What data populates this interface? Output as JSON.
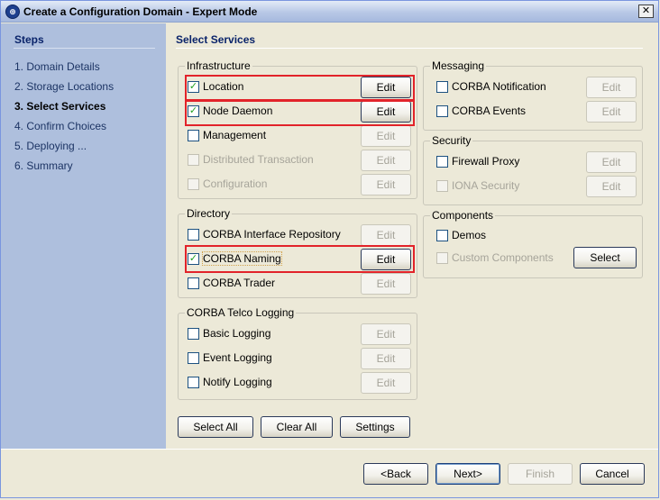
{
  "window": {
    "title": "Create a Configuration Domain - Expert Mode",
    "app_icon_glyph": "⊕",
    "close_glyph": "✕"
  },
  "steps": {
    "heading": "Steps",
    "items": [
      {
        "label": "1. Domain Details",
        "active": false
      },
      {
        "label": "2. Storage Locations",
        "active": false
      },
      {
        "label": "3. Select Services",
        "active": true
      },
      {
        "label": "4. Confirm Choices",
        "active": false
      },
      {
        "label": "5. Deploying ...",
        "active": false
      },
      {
        "label": "6. Summary",
        "active": false
      }
    ]
  },
  "main": {
    "heading": "Select Services"
  },
  "infrastructure": {
    "label": "Infrastructure",
    "items": [
      {
        "label": "Location",
        "checked": true,
        "enabled": true,
        "edit": "Edit",
        "edit_enabled": true
      },
      {
        "label": "Node Daemon",
        "checked": true,
        "enabled": true,
        "edit": "Edit",
        "edit_enabled": true
      },
      {
        "label": "Management",
        "checked": false,
        "enabled": true,
        "edit": "Edit",
        "edit_enabled": false
      },
      {
        "label": "Distributed Transaction",
        "checked": false,
        "enabled": false,
        "edit": "Edit",
        "edit_enabled": false
      },
      {
        "label": "Configuration",
        "checked": false,
        "enabled": false,
        "edit": "Edit",
        "edit_enabled": false
      }
    ]
  },
  "directory": {
    "label": "Directory",
    "items": [
      {
        "label": "CORBA Interface Repository",
        "checked": false,
        "enabled": true,
        "edit": "Edit",
        "edit_enabled": false
      },
      {
        "label": "CORBA Naming",
        "checked": true,
        "enabled": true,
        "edit": "Edit",
        "edit_enabled": true
      },
      {
        "label": "CORBA Trader",
        "checked": false,
        "enabled": true,
        "edit": "Edit",
        "edit_enabled": false
      }
    ]
  },
  "telco": {
    "label": "CORBA Telco Logging",
    "items": [
      {
        "label": "Basic Logging",
        "checked": false,
        "enabled": true,
        "edit": "Edit",
        "edit_enabled": false
      },
      {
        "label": "Event Logging",
        "checked": false,
        "enabled": true,
        "edit": "Edit",
        "edit_enabled": false
      },
      {
        "label": "Notify Logging",
        "checked": false,
        "enabled": true,
        "edit": "Edit",
        "edit_enabled": false
      }
    ]
  },
  "messaging": {
    "label": "Messaging",
    "items": [
      {
        "label": "CORBA Notification",
        "checked": false,
        "enabled": true,
        "edit": "Edit",
        "edit_enabled": false
      },
      {
        "label": "CORBA Events",
        "checked": false,
        "enabled": true,
        "edit": "Edit",
        "edit_enabled": false
      }
    ]
  },
  "security": {
    "label": "Security",
    "items": [
      {
        "label": "Firewall Proxy",
        "checked": false,
        "enabled": true,
        "edit": "Edit",
        "edit_enabled": false
      },
      {
        "label": "IONA Security",
        "checked": false,
        "enabled": false,
        "edit": "Edit",
        "edit_enabled": false
      }
    ]
  },
  "components": {
    "label": "Components",
    "demos": {
      "label": "Demos",
      "checked": false,
      "enabled": true
    },
    "custom": {
      "label": "Custom Components",
      "checked": false,
      "enabled": false
    },
    "select_button": "Select"
  },
  "actions": {
    "select_all": "Select All",
    "clear_all": "Clear All",
    "settings": "Settings"
  },
  "footer": {
    "back": "<Back",
    "next": "Next>",
    "finish": "Finish",
    "cancel": "Cancel"
  },
  "colors": {
    "steps_panel": "#aebfdd",
    "highlight": "#e2232a",
    "check": "#21a121"
  }
}
